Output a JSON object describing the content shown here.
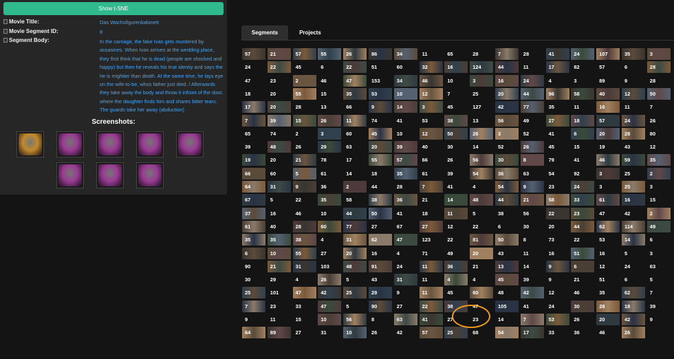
{
  "left_panel": {
    "tsne_button": "Show t-SNE",
    "fields": [
      {
        "label": "Movie Title:",
        "value": "Das Wachsfigurenkabinett"
      },
      {
        "label": "Movie Segment ID:",
        "value": "8"
      },
      {
        "label": "Segment Body:",
        "value": "In the carriage, the fake Ivan gets murdered by assasines. When Ivan arrives at the wedding place, they first think that he is dead (people are shocked and happy) but then he reveals his true identiy and says the he is mightier than death. At the same time, he lays eye on the wife-to-be, whos father just died. / Afterwards they take away the body and throw it infront of the door, where the daughter finds him and shares bitter tears. The guards take her away (abduction)"
      }
    ],
    "screenshots_title": "Screenshots:",
    "screenshots": [
      {
        "tint": "#c28a2a"
      },
      {
        "tint": "#9a3b93"
      },
      {
        "tint": "#9a3b93"
      },
      {
        "tint": "#9a3b93"
      },
      {
        "tint": "#9a3b93"
      },
      {
        "tint": "#9a3b93"
      },
      {
        "tint": "#9a3b93"
      },
      {
        "tint": "#9a3b93"
      }
    ]
  },
  "tabs": [
    {
      "label": "Segments",
      "active": true
    },
    {
      "label": "Projects",
      "active": false
    }
  ],
  "segments": {
    "rows": [
      [
        "57",
        "21",
        "57",
        "55",
        "26",
        "86",
        "34",
        "11",
        "65",
        "28",
        "7",
        "28",
        "41",
        "24",
        "107",
        "35",
        "3"
      ],
      [
        "24",
        "22",
        "45",
        "6",
        "22",
        "51",
        "60",
        "32",
        "16",
        "124",
        "44",
        "11",
        "17",
        "82",
        "57",
        "6",
        "28"
      ],
      [
        "47",
        "23",
        "2",
        "46",
        "47",
        "153",
        "34",
        "46",
        "10",
        "3",
        "16",
        "24",
        "4",
        "3",
        "89",
        "9",
        "28"
      ],
      [
        "18",
        "20",
        "55",
        "15",
        "35",
        "53",
        "10",
        "12",
        "7",
        "25",
        "20",
        "44",
        "96",
        "58",
        "40",
        "12",
        "50"
      ],
      [
        "17",
        "20",
        "28",
        "13",
        "66",
        "9",
        "14",
        "3",
        "45",
        "127",
        "42",
        "77",
        "35",
        "11",
        "16",
        "11",
        "7"
      ],
      [
        "7",
        "39",
        "15",
        "26",
        "11",
        "74",
        "41",
        "53",
        "38",
        "13",
        "56",
        "49",
        "27",
        "18",
        "57",
        "24",
        "26"
      ],
      [
        "65",
        "74",
        "2",
        "3",
        "60",
        "45",
        "10",
        "12",
        "50",
        "26",
        "3",
        "52",
        "41",
        "6",
        "20",
        "28",
        "80"
      ],
      [
        "39",
        "48",
        "26",
        "29",
        "63",
        "20",
        "39",
        "40",
        "30",
        "14",
        "52",
        "26",
        "45",
        "15",
        "19",
        "43",
        "12"
      ],
      [
        "19",
        "20",
        "21",
        "78",
        "17",
        "55",
        "57",
        "66",
        "26",
        "56",
        "30",
        "8",
        "79",
        "41",
        "46",
        "59",
        "35"
      ],
      [
        "66",
        "60",
        "5",
        "61",
        "14",
        "18",
        "35",
        "61",
        "39",
        "54",
        "36",
        "63",
        "54",
        "92",
        "3",
        "25",
        "2"
      ],
      [
        "64",
        "31",
        "9",
        "36",
        "2",
        "44",
        "28",
        "7",
        "41",
        "4",
        "54",
        "9",
        "23",
        "24",
        "3",
        "25",
        "3"
      ],
      [
        "67",
        "5",
        "22",
        "35",
        "58",
        "38",
        "36",
        "21",
        "14",
        "48",
        "44",
        "21",
        "58",
        "33",
        "61",
        "16",
        "15"
      ],
      [
        "37",
        "16",
        "46",
        "10",
        "44",
        "50",
        "41",
        "18",
        "11",
        "5",
        "38",
        "56",
        "22",
        "23",
        "47",
        "42",
        "2"
      ],
      [
        "61",
        "40",
        "28",
        "60",
        "77",
        "27",
        "67",
        "27",
        "12",
        "22",
        "6",
        "30",
        "20",
        "44",
        "62",
        "114",
        "49"
      ],
      [
        "35",
        "35",
        "38",
        "4",
        "31",
        "62",
        "47",
        "123",
        "22",
        "81",
        "50",
        "8",
        "73",
        "22",
        "53",
        "14",
        "6"
      ],
      [
        "6",
        "10",
        "55",
        "27",
        "20",
        "16",
        "4",
        "71",
        "49",
        "20",
        "43",
        "11",
        "16",
        "51",
        "16",
        "5",
        "3"
      ],
      [
        "90",
        "21",
        "31",
        "103",
        "48",
        "91",
        "24",
        "11",
        "36",
        "21",
        "13",
        "14",
        "9",
        "6",
        "12",
        "24",
        "63"
      ],
      [
        "30",
        "29",
        "4",
        "26",
        "5",
        "43",
        "31",
        "11",
        "4",
        "4",
        "45",
        "39",
        "9",
        "21",
        "51",
        "6",
        "5"
      ],
      [
        "25",
        "101",
        "47",
        "42",
        "25",
        "29",
        "9",
        "11",
        "45",
        "60",
        "48",
        "42",
        "12",
        "46",
        "35",
        "62",
        "7"
      ],
      [
        "7",
        "23",
        "33",
        "47",
        "5",
        "90",
        "27",
        "22",
        "38",
        "47",
        "105",
        "41",
        "24",
        "30",
        "28",
        "18",
        "39"
      ],
      [
        "9",
        "11",
        "15",
        "10",
        "56",
        "8",
        "63",
        "41",
        "27",
        "23",
        "14",
        "7",
        "53",
        "26",
        "20",
        "42",
        "9"
      ],
      [
        "64",
        "89",
        "27",
        "31",
        "10",
        "26",
        "42",
        "57",
        "25",
        "68",
        "54",
        "17",
        "33",
        "36",
        "46",
        "26"
      ]
    ]
  },
  "highlighted_segment": "47"
}
